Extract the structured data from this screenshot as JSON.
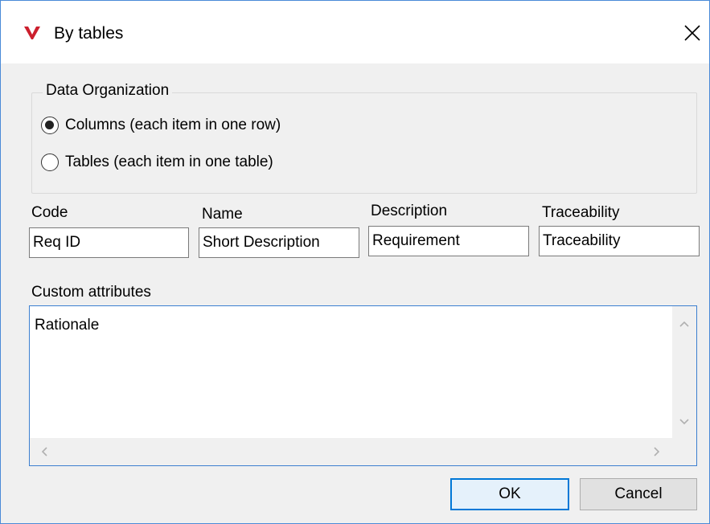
{
  "window": {
    "title": "By tables",
    "brand_color": "#cc1f2d"
  },
  "data_organization": {
    "legend": "Data Organization",
    "options": [
      {
        "label": "Columns (each  item in one row)",
        "checked": true
      },
      {
        "label": "Tables (each item in one table)",
        "checked": false
      }
    ]
  },
  "fields": {
    "code": {
      "label": "Code",
      "value": "Req ID"
    },
    "name": {
      "label": "Name",
      "value": "Short Description"
    },
    "description": {
      "label": "Description",
      "value": "Requirement"
    },
    "traceability": {
      "label": "Traceability",
      "value": "Traceability"
    }
  },
  "custom_attributes": {
    "label": "Custom attributes",
    "value": "Rationale"
  },
  "buttons": {
    "ok": "OK",
    "cancel": "Cancel"
  },
  "icons": {
    "app": "app-logo-icon",
    "close": "close-icon"
  }
}
